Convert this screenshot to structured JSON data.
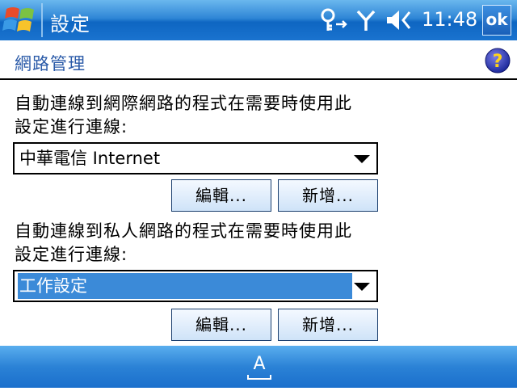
{
  "titlebar": {
    "title": "設定",
    "clock": "11:48",
    "ok_label": "ok",
    "icons": [
      "windows-start-icon",
      "connectivity-icon",
      "signal-icon",
      "volume-icon"
    ]
  },
  "header": {
    "title": "網路管理",
    "help_icon": "help-icon"
  },
  "internet_section": {
    "description_line1": "自動連線到網際網路的程式在需要時使用此",
    "description_line2": "設定進行連線:",
    "selected": "中華電信 Internet",
    "edit_label": "編輯...",
    "new_label": "新增..."
  },
  "private_section": {
    "description_line1": "自動連線到私人網路的程式在需要時使用此",
    "description_line2": "設定進行連線:",
    "selected": "工作設定",
    "edit_label": "編輯...",
    "new_label": "新增..."
  },
  "bottombar": {
    "sip_label": "A",
    "sip_icon": "keyboard-input-icon"
  },
  "colors": {
    "titlebar_blue": "#1a73cf",
    "header_text": "#2a5aa8",
    "selection_blue": "#3b8ad8",
    "button_border": "#1b3f6e"
  }
}
